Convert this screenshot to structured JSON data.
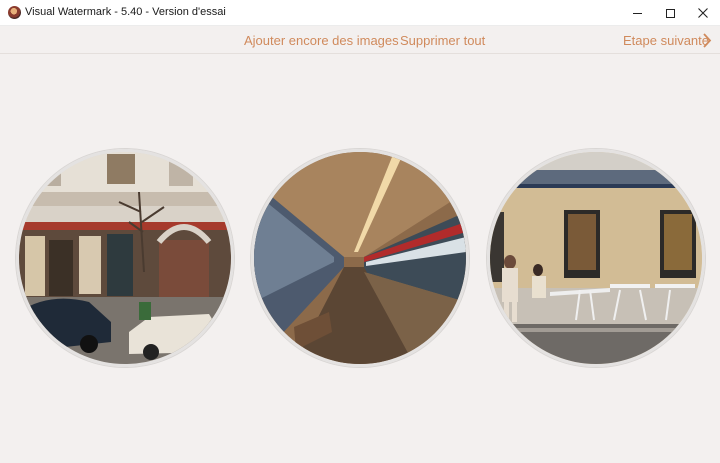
{
  "window": {
    "title": "Visual Watermark - 5.40 - Version d'essai",
    "icon": "app-logo-icon",
    "minimize_icon": "minimize-icon",
    "maximize_icon": "maximize-icon",
    "close_icon": "close-icon"
  },
  "toolbar": {
    "add_images_label": "Ajouter encore des images",
    "remove_all_label": "Supprimer tout",
    "next_step_label": "Etape suivante",
    "next_icon": "chevron-right-icon",
    "accent_color": "#d08a5c"
  },
  "images": [
    {
      "name": "street-storefront-photo",
      "subject": "street storefront with parked cars"
    },
    {
      "name": "subway-station-photo",
      "subject": "subway platform with train"
    },
    {
      "name": "cafe-terrace-photo",
      "subject": "cafe terrace with people"
    }
  ],
  "colors": {
    "background": "#f3f0ef",
    "titlebar": "#ffffff"
  }
}
